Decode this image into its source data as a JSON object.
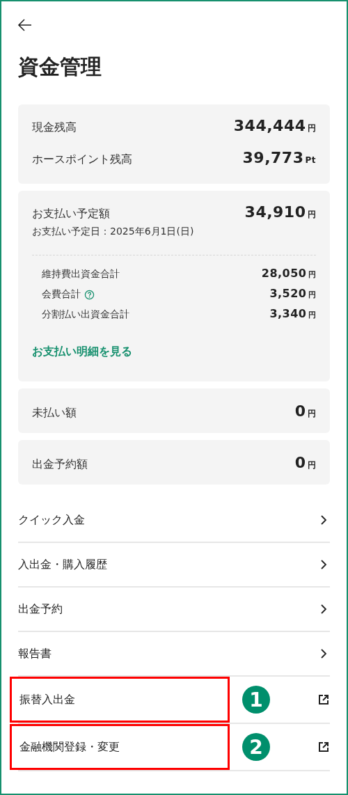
{
  "header": {
    "title": "資金管理"
  },
  "balances": [
    {
      "label": "現金残高",
      "amount": "344,444",
      "unit": "円"
    },
    {
      "label": "ホースポイント残高",
      "amount": "39,773",
      "unit": "Pt"
    }
  ],
  "payment": {
    "label": "お支払い予定額",
    "amount": "34,910",
    "unit": "円",
    "date": "お支払い予定日：2025年6月1日(日)",
    "breakdown": [
      {
        "label": "維持費出資金合計",
        "amount": "28,050",
        "unit": "円",
        "help": false
      },
      {
        "label": "会費合計",
        "amount": "3,520",
        "unit": "円",
        "help": true
      },
      {
        "label": "分割払い出資金合計",
        "amount": "3,340",
        "unit": "円",
        "help": false
      }
    ],
    "link": "お支払い明細を見る"
  },
  "summaries": [
    {
      "label": "未払い額",
      "amount": "0",
      "unit": "円"
    },
    {
      "label": "出金予約額",
      "amount": "0",
      "unit": "円"
    }
  ],
  "menu": [
    {
      "label": "クイック入金",
      "kind": "internal",
      "highlighted": false
    },
    {
      "label": "入出金・購入履歴",
      "kind": "internal",
      "highlighted": false
    },
    {
      "label": "出金予約",
      "kind": "internal",
      "highlighted": false
    },
    {
      "label": "報告書",
      "kind": "internal",
      "highlighted": false
    },
    {
      "label": "振替入出金",
      "kind": "external",
      "highlighted": true,
      "callout": "1"
    },
    {
      "label": "金融機関登録・変更",
      "kind": "external",
      "highlighted": true,
      "callout": "2"
    }
  ]
}
